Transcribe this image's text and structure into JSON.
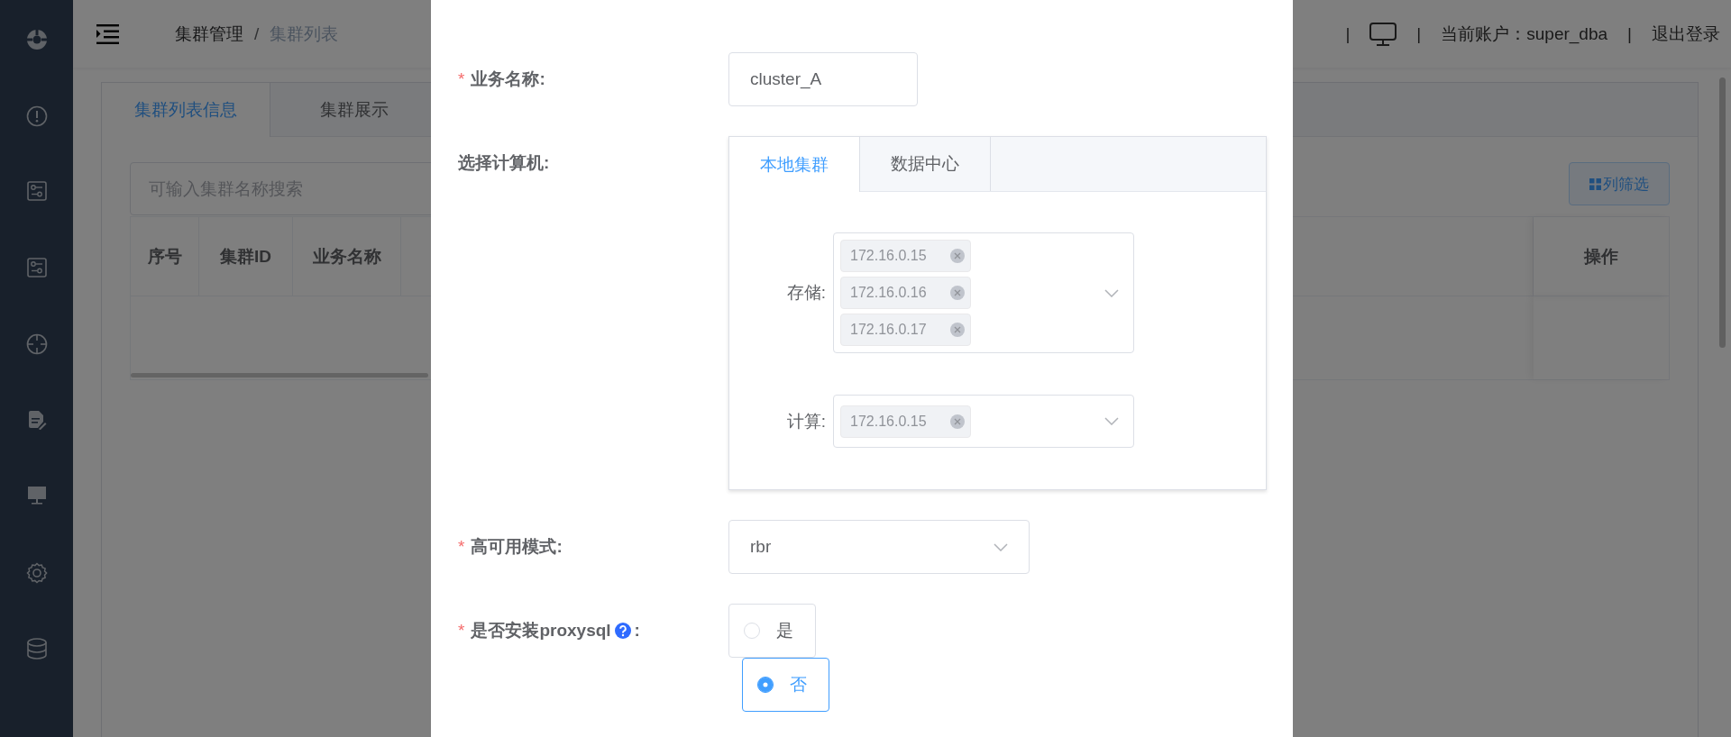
{
  "header": {
    "breadcrumb": [
      "集群管理",
      "集群列表"
    ],
    "separator": "/",
    "right": [
      {
        "kind": "sep",
        "text": "|"
      },
      {
        "kind": "screen"
      },
      {
        "kind": "sep",
        "text": "|"
      },
      {
        "kind": "text",
        "text": "当前账户：super_dba"
      },
      {
        "kind": "sep",
        "text": "|"
      },
      {
        "kind": "link",
        "text": "退出登录"
      }
    ]
  },
  "page": {
    "tabs": [
      {
        "label": "集群列表信息",
        "selected": true
      },
      {
        "label": "集群展示",
        "selected": false
      }
    ],
    "search": {
      "placeholder": "可输入集群名称搜索"
    },
    "column_filter_button": "列筛选",
    "table": {
      "columns": [
        "序号",
        "集群ID",
        "业务名称"
      ],
      "action_column": "操作"
    }
  },
  "dialog": {
    "fields": [
      {
        "kind": "text",
        "required_mark": "*",
        "label": "业务名称:",
        "value": "cluster_A"
      },
      {
        "kind": "machines",
        "label": "选择计算机:",
        "tabs": [
          {
            "label": "本地集群",
            "selected": true
          },
          {
            "label": "数据中心",
            "selected": false
          }
        ],
        "selects": [
          {
            "label": "存储:",
            "tags": [
              "172.16.0.15",
              "172.16.0.16",
              "172.16.0.17"
            ]
          },
          {
            "label": "计算:",
            "tags": [
              "172.16.0.15"
            ]
          }
        ]
      },
      {
        "kind": "select",
        "required_mark": "*",
        "label": "高可用模式:",
        "value": "rbr"
      },
      {
        "kind": "radio",
        "required_mark": "*",
        "label": "是否安装proxysql",
        "help": true,
        "label_end": ":",
        "options": [
          {
            "label": "是",
            "selected": false
          },
          {
            "label": "否",
            "selected": true
          }
        ]
      }
    ]
  }
}
